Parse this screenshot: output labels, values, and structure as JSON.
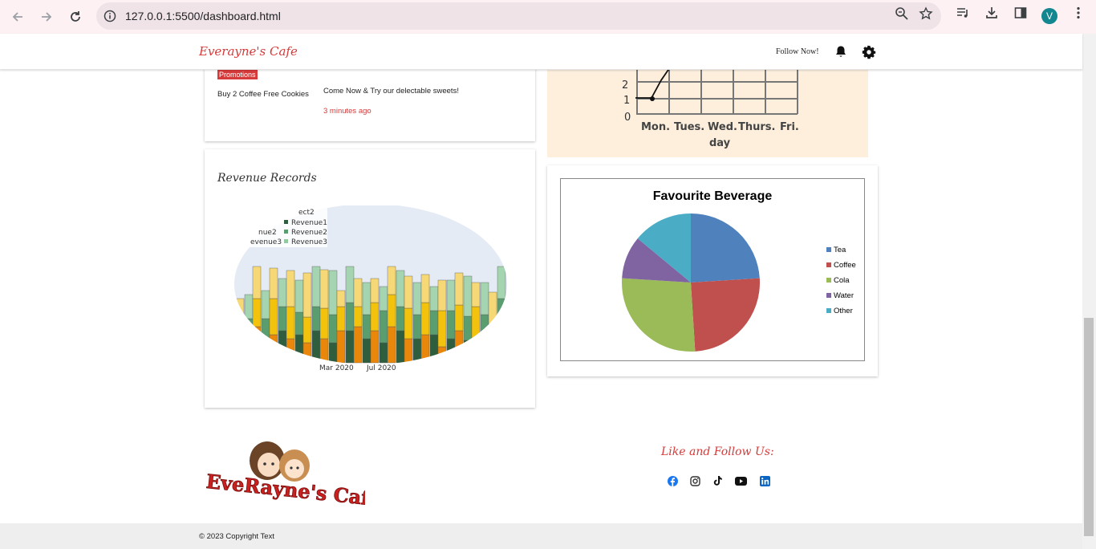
{
  "browser": {
    "url": "127.0.0.1:5500/dashboard.html",
    "avatar_letter": "V"
  },
  "header": {
    "brand": "Everayne's Cafe",
    "follow_label": "Follow Now!"
  },
  "promotions": {
    "badge": "Promotions",
    "item": "Buy 2 Coffee Free Cookies",
    "message": "Come Now & Try our delectable sweets!",
    "time": "3 minutes ago"
  },
  "sales_chart": {
    "y_ticks": [
      "0",
      "1",
      "2"
    ],
    "days": [
      "Mon.",
      "Tues.",
      "Wed.",
      "Thurs.",
      "Fri."
    ],
    "x_label": "day"
  },
  "revenue": {
    "title": "Revenue Records",
    "legend": [
      "Revenue1",
      "Revenue2",
      "Revenue3"
    ],
    "legend_left": [
      "nue2",
      "evenue3"
    ],
    "legend_top": "ect2",
    "x_ticks": [
      "Mar 2020",
      "Jul 2020"
    ]
  },
  "chart_data": {
    "type": "pie",
    "title": "Favourite Beverage",
    "labels": [
      "Tea",
      "Coffee",
      "Cola",
      "Water",
      "Other"
    ],
    "values": [
      24,
      25,
      27,
      10,
      14
    ],
    "colors": [
      "#4f81bd",
      "#c0504d",
      "#9bbb59",
      "#8064a2",
      "#4bacc6"
    ]
  },
  "footer": {
    "follow_title": "Like and Follow Us:",
    "copyright": "© 2023 Copyright Text",
    "logo_text": "EveRayne's Cafe"
  },
  "colors": {
    "accent": "#d63a3a"
  }
}
